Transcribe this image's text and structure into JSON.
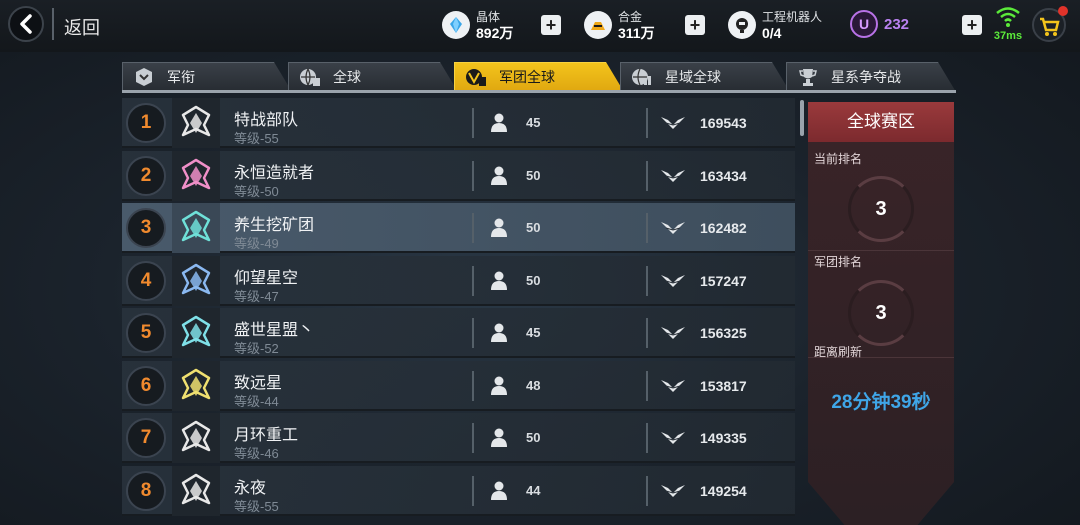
{
  "header": {
    "back_label": "返回",
    "resources": [
      {
        "name": "晶体",
        "value": "892万",
        "icon": "crystal-icon"
      },
      {
        "name": "合金",
        "value": "311万",
        "icon": "alloy-icon"
      },
      {
        "name": "工程机器人",
        "value": "0/4",
        "icon": "robot-icon"
      }
    ],
    "premium_symbol": "U",
    "premium_value": "232",
    "latency": "37ms",
    "colors": {
      "premium": "#b981f0",
      "latency": "#5bea3a"
    }
  },
  "tabs": [
    {
      "label": "军衔",
      "icon": "rank-badge-icon",
      "active": false
    },
    {
      "label": "全球",
      "icon": "globe-icon",
      "active": false
    },
    {
      "label": "军团全球",
      "icon": "legion-globe-icon",
      "active": true
    },
    {
      "label": "星域全球",
      "icon": "star-domain-icon",
      "active": false
    },
    {
      "label": "星系争夺战",
      "icon": "trophy-icon",
      "active": false
    }
  ],
  "rankings": [
    {
      "rank": "1",
      "name": "特战部队",
      "level": "等级-55",
      "members": "45",
      "power": "169543",
      "emblem_color": "#e8e8e8"
    },
    {
      "rank": "2",
      "name": "永恒造就者",
      "level": "等级-50",
      "members": "50",
      "power": "163434",
      "emblem_color": "#f08fc8"
    },
    {
      "rank": "3",
      "name": "养生挖矿团",
      "level": "等级-49",
      "members": "50",
      "power": "162482",
      "emblem_color": "#6fe0d8",
      "highlight": true
    },
    {
      "rank": "4",
      "name": "仰望星空",
      "level": "等级-47",
      "members": "50",
      "power": "157247",
      "emblem_color": "#8ab8f0"
    },
    {
      "rank": "5",
      "name": "盛世星盟丶",
      "level": "等级-52",
      "members": "45",
      "power": "156325",
      "emblem_color": "#7fe0e8"
    },
    {
      "rank": "6",
      "name": "致远星",
      "level": "等级-44",
      "members": "48",
      "power": "153817",
      "emblem_color": "#f0e070"
    },
    {
      "rank": "7",
      "name": "月环重工",
      "level": "等级-46",
      "members": "50",
      "power": "149335",
      "emblem_color": "#e8e8e8"
    },
    {
      "rank": "8",
      "name": "永夜",
      "level": "等级-55",
      "members": "44",
      "power": "149254",
      "emblem_color": "#e8e8e8"
    }
  ],
  "side_panel": {
    "title": "全球赛区",
    "current_rank_label": "当前排名",
    "current_rank": "3",
    "legion_rank_label": "军团排名",
    "legion_rank": "3",
    "refresh_label": "距离刷新",
    "countdown": "28分钟39秒"
  }
}
